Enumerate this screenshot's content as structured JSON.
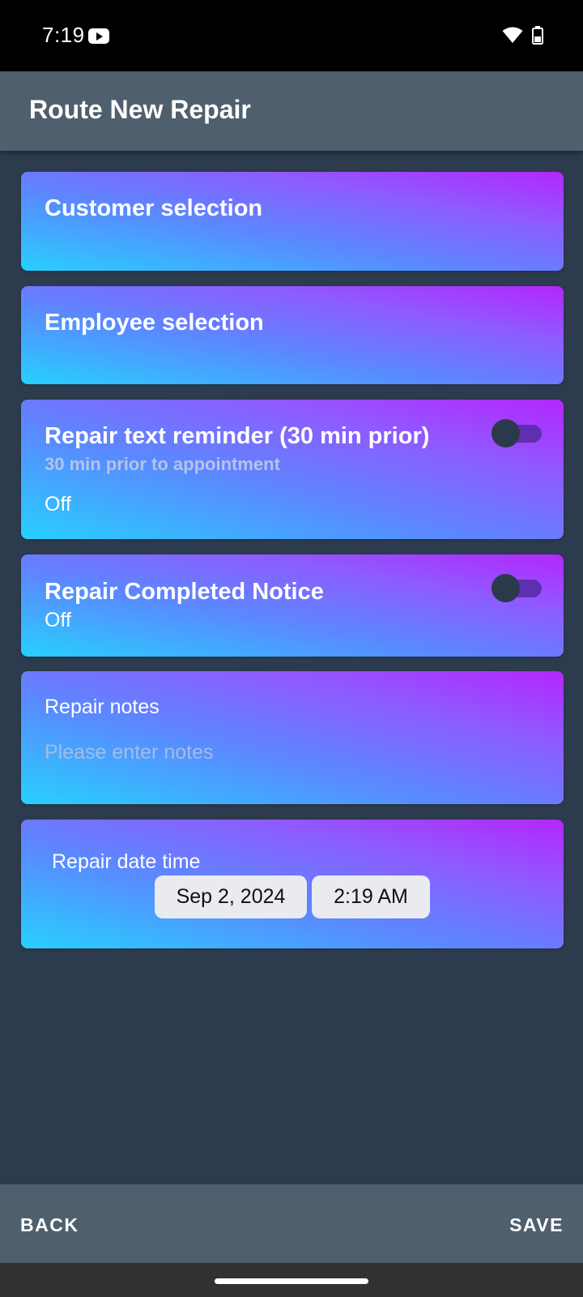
{
  "status_bar": {
    "time": "7:19",
    "icons": [
      "youtube-icon",
      "wifi-icon",
      "battery-icon"
    ]
  },
  "app_bar": {
    "title": "Route New Repair"
  },
  "cards": {
    "customer": {
      "title": "Customer selection"
    },
    "employee": {
      "title": "Employee selection"
    },
    "reminder": {
      "title": "Repair text reminder (30 min prior)",
      "subtitle": "30 min prior to appointment",
      "value": "Off",
      "enabled": false
    },
    "completed": {
      "title": "Repair Completed Notice",
      "value": "Off",
      "enabled": false
    },
    "notes": {
      "label": "Repair notes",
      "value": "",
      "placeholder": "Please enter notes"
    },
    "datetime": {
      "label": "Repair date time",
      "date": "Sep 2, 2024",
      "time": "2:19 AM"
    }
  },
  "bottom_bar": {
    "back_label": "BACK",
    "save_label": "SAVE"
  },
  "colors": {
    "background": "#2d3b4e",
    "app_bar": "#505f6e",
    "card_gradient_start": "#27d0fe",
    "card_gradient_end": "#b426fe",
    "toggle_track": "#5e2fb0"
  }
}
